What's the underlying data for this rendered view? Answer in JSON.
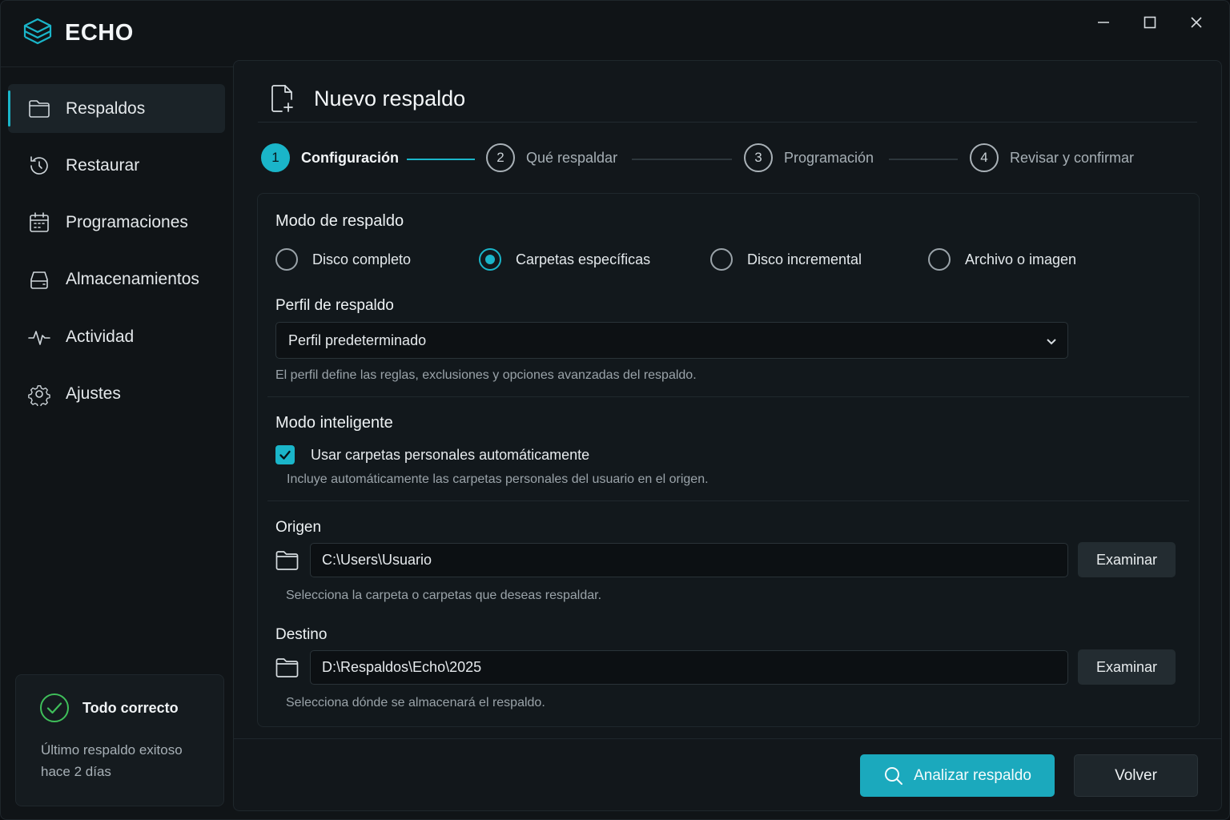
{
  "app": {
    "name": "ECHO",
    "accent_color": "#1ab5c9"
  },
  "window_controls": [
    "minimize-icon",
    "maximize-icon",
    "close-icon"
  ],
  "sidebar": {
    "items": [
      {
        "label": "Respaldos",
        "icon": "folder-icon",
        "active": true
      },
      {
        "label": "Restaurar",
        "icon": "history-icon",
        "active": false
      },
      {
        "label": "Programaciones",
        "icon": "calendar-icon",
        "active": false
      },
      {
        "label": "Almacenamientos",
        "icon": "drive-icon",
        "active": false
      },
      {
        "label": "Actividad",
        "icon": "activity-icon",
        "active": false
      },
      {
        "label": "Ajustes",
        "icon": "gear-icon",
        "active": false
      }
    ],
    "status": {
      "title": "Todo correcto",
      "line1": "Último respaldo exitoso",
      "line2": "hace 2 días",
      "color": "#3fbf5a"
    }
  },
  "main": {
    "title": "Nuevo respaldo",
    "steps": [
      {
        "number": "1",
        "label": "Configuración",
        "active": true
      },
      {
        "number": "2",
        "label": "Qué respaldar",
        "active": false
      },
      {
        "number": "3",
        "label": "Programación",
        "active": false
      },
      {
        "number": "4",
        "label": "Revisar y confirmar",
        "active": false
      }
    ],
    "mode": {
      "title": "Modo de respaldo",
      "options": [
        {
          "label": "Disco completo",
          "selected": false
        },
        {
          "label": "Carpetas específicas",
          "selected": true
        },
        {
          "label": "Disco incremental",
          "selected": false
        },
        {
          "label": "Archivo o imagen",
          "selected": false
        }
      ]
    },
    "profile": {
      "title": "Perfil de respaldo",
      "selected": "Perfil predeterminado",
      "helper": "El perfil define las reglas, exclusiones y opciones avanzadas del respaldo."
    },
    "smart": {
      "title": "Modo inteligente",
      "checkbox_label": "Usar carpetas personales automáticamente",
      "checked": true,
      "helper": "Incluye automáticamente las carpetas personales del usuario en el origen."
    },
    "source": {
      "title": "Origen",
      "value": "C:\\Users\\Usuario",
      "button": "Examinar",
      "helper": "Selecciona la carpeta o carpetas que deseas respaldar."
    },
    "destination": {
      "title": "Destino",
      "value": "D:\\Respaldos\\Echo\\2025",
      "button": "Examinar",
      "helper": "Selecciona dónde se almacenará el respaldo."
    },
    "footer": {
      "primary": "Analizar respaldo",
      "secondary": "Volver"
    }
  }
}
